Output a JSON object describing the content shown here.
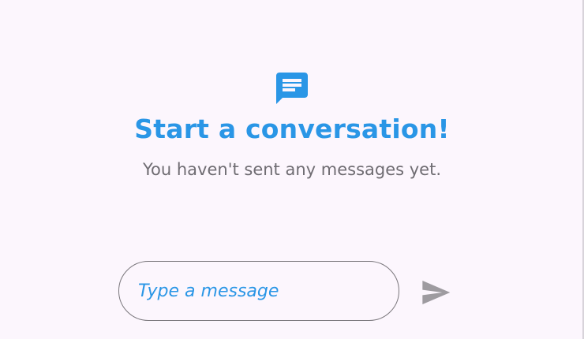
{
  "colors": {
    "accent": "#2a96e6",
    "muted": "#6f6c72",
    "send_icon": "#9e9ba0",
    "background": "#fcf6fd"
  },
  "empty_state": {
    "icon": "chat-bubble-icon",
    "title": "Start a conversation!",
    "subtitle": "You haven't sent any messages yet."
  },
  "composer": {
    "value": "",
    "placeholder": "Type a message",
    "send_icon": "send-icon"
  }
}
